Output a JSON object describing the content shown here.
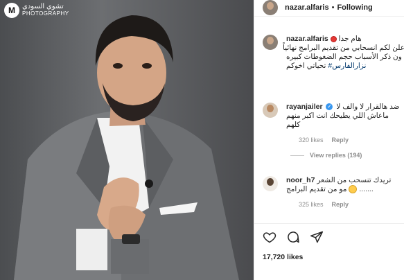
{
  "watermark": {
    "logo_letter": "M",
    "arabic_text": "تشوي السودي",
    "english_text": "PHOTOGRAPHY"
  },
  "header": {
    "username": "nazar.alfaris",
    "separator": "•",
    "follow_status": "Following"
  },
  "caption": {
    "username": "nazar.alfaris",
    "line1": "هام جدا",
    "line2": "علن لكم انسحابي من تقديم البرامج نهائياً",
    "line3": "ون ذكر الأسباب حجم الضغوطات كبيره",
    "line4": "تحياتي اخوكم",
    "hashtag": "#نزارالفارس"
  },
  "comments": [
    {
      "username": "rayanjailer",
      "verified": true,
      "line1": "ضد هالقرار لا والف لا",
      "line2": "ماعاش اللي يطيحك انت اكبر منهم",
      "line3": "كلهم",
      "likes": "320 likes",
      "reply": "Reply",
      "view_replies": "View replies (194)"
    },
    {
      "username": "noor_h7",
      "line1": "تريدك تنسحب من الشعر",
      "line2": "مو من تقديم البرامج",
      "dots": ".......",
      "likes": "325 likes",
      "reply": "Reply"
    }
  ],
  "actions": {
    "like_icon": "heart-icon",
    "comment_icon": "comment-icon",
    "share_icon": "share-icon"
  },
  "likes_count": "17,720 likes",
  "colors": {
    "hashtag": "#00376b",
    "verified": "#3897f0",
    "muted": "#8e8e8e"
  }
}
